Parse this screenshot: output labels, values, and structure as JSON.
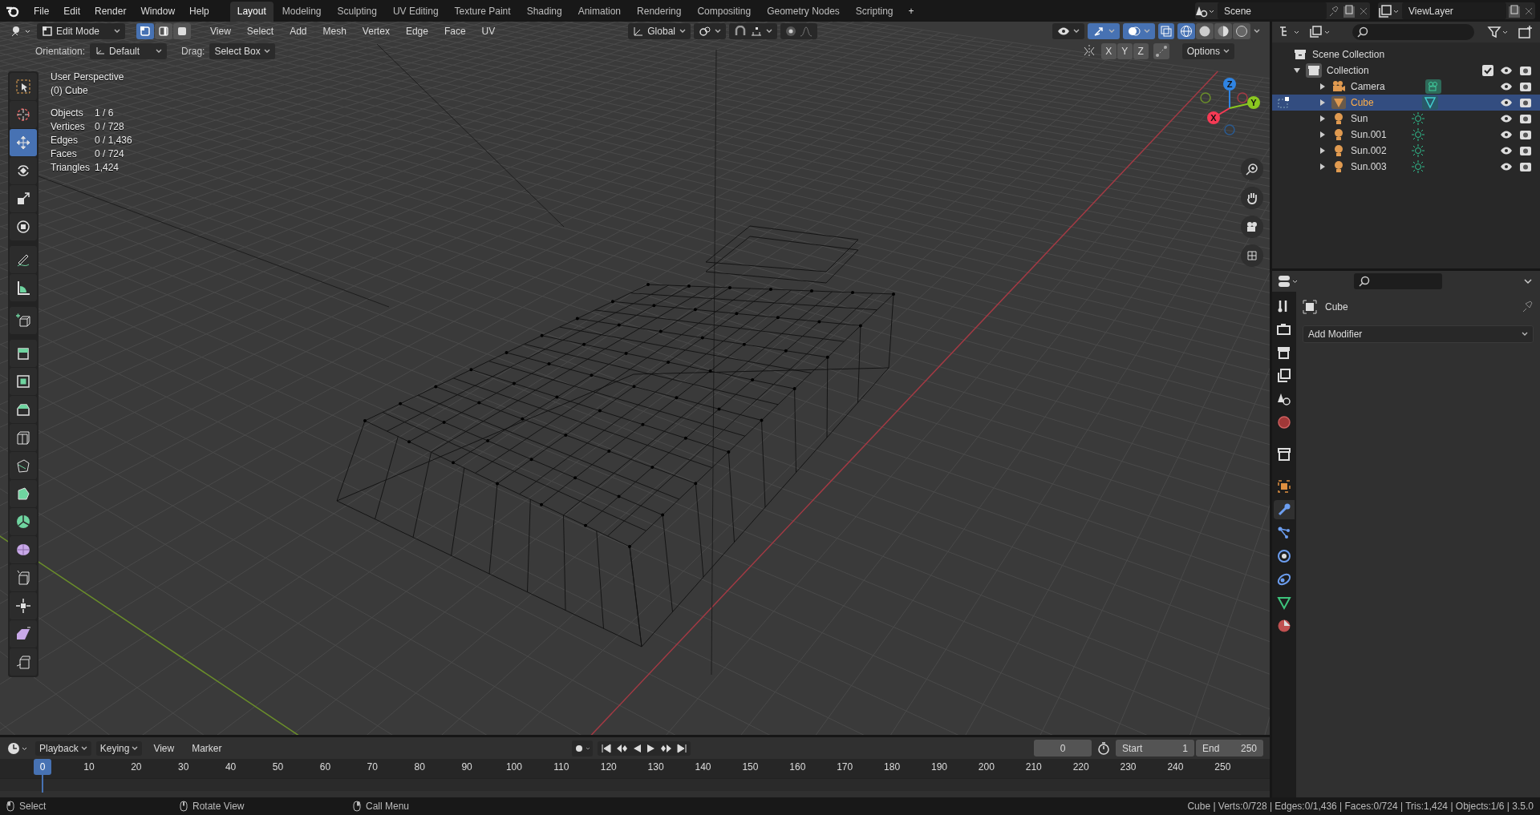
{
  "top_bar": {
    "menus": [
      "File",
      "Edit",
      "Render",
      "Window",
      "Help"
    ],
    "workspaces": [
      {
        "label": "Layout",
        "selected": true
      },
      {
        "label": "Modeling",
        "selected": false
      },
      {
        "label": "Sculpting",
        "selected": false
      },
      {
        "label": "UV Editing",
        "selected": false
      },
      {
        "label": "Texture Paint",
        "selected": false
      },
      {
        "label": "Shading",
        "selected": false
      },
      {
        "label": "Animation",
        "selected": false
      },
      {
        "label": "Rendering",
        "selected": false
      },
      {
        "label": "Compositing",
        "selected": false
      },
      {
        "label": "Geometry Nodes",
        "selected": false
      },
      {
        "label": "Scripting",
        "selected": false
      }
    ],
    "add_tab": "+",
    "scene": "Scene",
    "view_layer": "ViewLayer"
  },
  "viewport_header": {
    "mode": "Edit Mode",
    "select_modes": [
      {
        "kind": "vertex",
        "selected": true
      },
      {
        "kind": "edge",
        "selected": false
      },
      {
        "kind": "face",
        "selected": false
      }
    ],
    "menus": [
      "View",
      "Select",
      "Add",
      "Mesh",
      "Vertex",
      "Edge",
      "Face",
      "UV"
    ],
    "transform_orientation": "Global",
    "shading": [
      {
        "kind": "wireframe",
        "selected": true
      },
      {
        "kind": "solid",
        "selected": false
      },
      {
        "kind": "material",
        "selected": false
      },
      {
        "kind": "rendered",
        "selected": false
      }
    ]
  },
  "tool_settings": {
    "orientation_label": "Orientation:",
    "orientation": "Default",
    "drag_label": "Drag:",
    "drag": "Select Box",
    "mirror_axes": [
      "X",
      "Y",
      "Z"
    ],
    "options": "Options"
  },
  "overlay": {
    "view_name": "User Perspective",
    "object": "(0) Cube",
    "stats": [
      {
        "label": "Objects",
        "value": "1 / 6"
      },
      {
        "label": "Vertices",
        "value": "0 / 728"
      },
      {
        "label": "Edges",
        "value": "0 / 1,436"
      },
      {
        "label": "Faces",
        "value": "0 / 724"
      },
      {
        "label": "Triangles",
        "value": "1,424"
      }
    ]
  },
  "tools": [
    {
      "kind": "select",
      "selected": false
    },
    {
      "kind": "cursor",
      "selected": false
    },
    {
      "kind": "move",
      "selected": true
    },
    {
      "kind": "rotate",
      "selected": false
    },
    {
      "kind": "scale",
      "selected": false
    },
    {
      "kind": "transform",
      "selected": false
    },
    {
      "kind": "annotate",
      "selected": false
    },
    {
      "kind": "measure",
      "selected": false
    },
    {
      "kind": "add_cube",
      "selected": false
    },
    {
      "kind": "extrude",
      "selected": false
    },
    {
      "kind": "inset",
      "selected": false
    },
    {
      "kind": "bevel",
      "selected": false
    },
    {
      "kind": "loop_cut",
      "selected": false
    },
    {
      "kind": "knife",
      "selected": false
    },
    {
      "kind": "poly_build",
      "selected": false
    },
    {
      "kind": "spin",
      "selected": false
    },
    {
      "kind": "smooth",
      "selected": false
    },
    {
      "kind": "edge_slide",
      "selected": false
    },
    {
      "kind": "shrink",
      "selected": false
    },
    {
      "kind": "shear",
      "selected": false
    },
    {
      "kind": "rip",
      "selected": false
    }
  ],
  "gizmo_axes": [
    {
      "label": "X",
      "color": "#f53a54"
    },
    {
      "label": "Y",
      "color": "#8ac720"
    },
    {
      "label": "Z",
      "color": "#2f84e3"
    }
  ],
  "outliner": {
    "root": "Scene Collection",
    "collection": {
      "label": "Collection",
      "expanded": true,
      "children": [
        {
          "label": "Camera",
          "kind": "camera",
          "selected": false
        },
        {
          "label": "Cube",
          "kind": "mesh",
          "selected": true
        },
        {
          "label": "Sun",
          "kind": "light",
          "selected": false
        },
        {
          "label": "Sun.001",
          "kind": "light",
          "selected": false
        },
        {
          "label": "Sun.002",
          "kind": "light",
          "selected": false
        },
        {
          "label": "Sun.003",
          "kind": "light",
          "selected": false
        }
      ]
    }
  },
  "properties": {
    "object": "Cube",
    "add_modifier": "Add Modifier",
    "tabs": [
      {
        "kind": "tool",
        "selected": false
      },
      {
        "kind": "render",
        "selected": false
      },
      {
        "kind": "output",
        "selected": false
      },
      {
        "kind": "view_layer",
        "selected": false
      },
      {
        "kind": "scene",
        "selected": false
      },
      {
        "kind": "world",
        "selected": false
      },
      {
        "kind": "collection",
        "selected": false
      },
      {
        "kind": "object",
        "selected": false
      },
      {
        "kind": "modifiers",
        "selected": true
      },
      {
        "kind": "particles",
        "selected": false
      },
      {
        "kind": "physics",
        "selected": false
      },
      {
        "kind": "constraints",
        "selected": false
      },
      {
        "kind": "data",
        "selected": false
      },
      {
        "kind": "material",
        "selected": false
      }
    ]
  },
  "timeline": {
    "menus": [
      "Playback",
      "Keying",
      "View",
      "Marker"
    ],
    "current_frame": "0",
    "start_label": "Start",
    "start": "1",
    "end_label": "End",
    "end": "250",
    "playhead": "0",
    "ticks": [
      "10",
      "20",
      "30",
      "40",
      "50",
      "60",
      "70",
      "80",
      "90",
      "100",
      "110",
      "120",
      "130",
      "140",
      "150",
      "160",
      "170",
      "180",
      "190",
      "200",
      "210",
      "220",
      "230",
      "240",
      "250"
    ]
  },
  "status_bar": {
    "hints": [
      "Select",
      "Rotate View",
      "Call Menu"
    ],
    "stats": "Cube | Verts:0/728 | Edges:0/1,436 | Faces:0/724 | Tris:1,424 | Objects:1/6 | 3.5.0"
  }
}
